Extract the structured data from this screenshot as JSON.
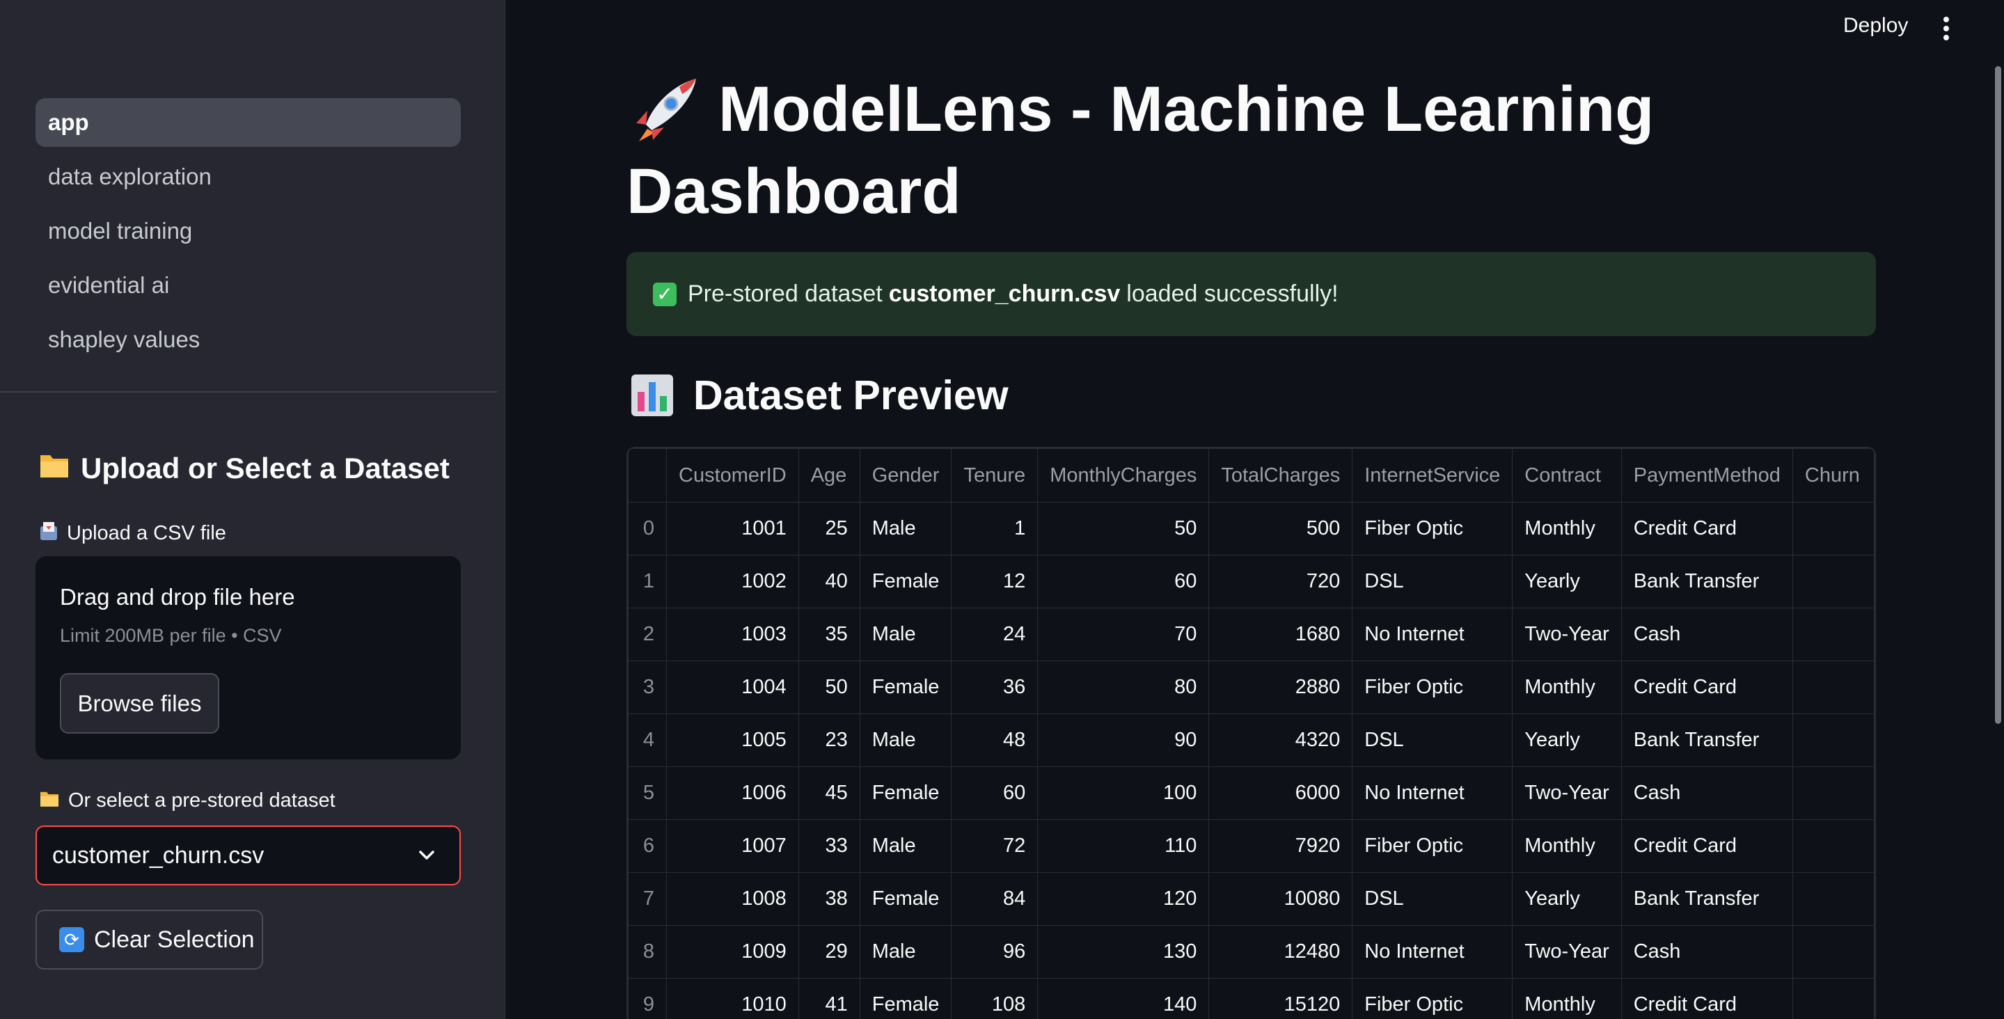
{
  "sidebar": {
    "nav": [
      "app",
      "data exploration",
      "model training",
      "evidential ai",
      "shapley values"
    ],
    "upload_header": "Upload or Select a Dataset",
    "upload_label": "Upload a CSV file",
    "dropzone_title": "Drag and drop file here",
    "dropzone_limit": "Limit 200MB per file • CSV",
    "browse_label": "Browse files",
    "prestored_label": "Or select a pre-stored dataset",
    "selected_dataset": "customer_churn.csv",
    "clear_label": "Clear Selection"
  },
  "topbar": {
    "deploy_label": "Deploy"
  },
  "main": {
    "title": "ModelLens - Machine Learning Dashboard",
    "alert_prefix": "Pre-stored dataset",
    "alert_file": "customer_churn.csv",
    "alert_suffix": "loaded successfully!",
    "section_title": "Dataset Preview"
  },
  "table": {
    "columns": [
      "",
      "CustomerID",
      "Age",
      "Gender",
      "Tenure",
      "MonthlyCharges",
      "TotalCharges",
      "InternetService",
      "Contract",
      "PaymentMethod",
      "Churn"
    ],
    "rows": [
      [
        "0",
        "1001",
        "25",
        "Male",
        "1",
        "50",
        "500",
        "Fiber Optic",
        "Monthly",
        "Credit Card",
        ""
      ],
      [
        "1",
        "1002",
        "40",
        "Female",
        "12",
        "60",
        "720",
        "DSL",
        "Yearly",
        "Bank Transfer",
        ""
      ],
      [
        "2",
        "1003",
        "35",
        "Male",
        "24",
        "70",
        "1680",
        "No Internet",
        "Two-Year",
        "Cash",
        ""
      ],
      [
        "3",
        "1004",
        "50",
        "Female",
        "36",
        "80",
        "2880",
        "Fiber Optic",
        "Monthly",
        "Credit Card",
        ""
      ],
      [
        "4",
        "1005",
        "23",
        "Male",
        "48",
        "90",
        "4320",
        "DSL",
        "Yearly",
        "Bank Transfer",
        ""
      ],
      [
        "5",
        "1006",
        "45",
        "Female",
        "60",
        "100",
        "6000",
        "No Internet",
        "Two-Year",
        "Cash",
        ""
      ],
      [
        "6",
        "1007",
        "33",
        "Male",
        "72",
        "110",
        "7920",
        "Fiber Optic",
        "Monthly",
        "Credit Card",
        ""
      ],
      [
        "7",
        "1008",
        "38",
        "Female",
        "84",
        "120",
        "10080",
        "DSL",
        "Yearly",
        "Bank Transfer",
        ""
      ],
      [
        "8",
        "1009",
        "29",
        "Male",
        "96",
        "130",
        "12480",
        "No Internet",
        "Two-Year",
        "Cash",
        ""
      ],
      [
        "9",
        "1010",
        "41",
        "Female",
        "108",
        "140",
        "15120",
        "Fiber Optic",
        "Monthly",
        "Credit Card",
        ""
      ]
    ]
  },
  "colors": {
    "accent": "#ff4b4b",
    "success_bg": "#1f3326",
    "sidebar_bg": "#262730",
    "main_bg": "#0e1117"
  }
}
